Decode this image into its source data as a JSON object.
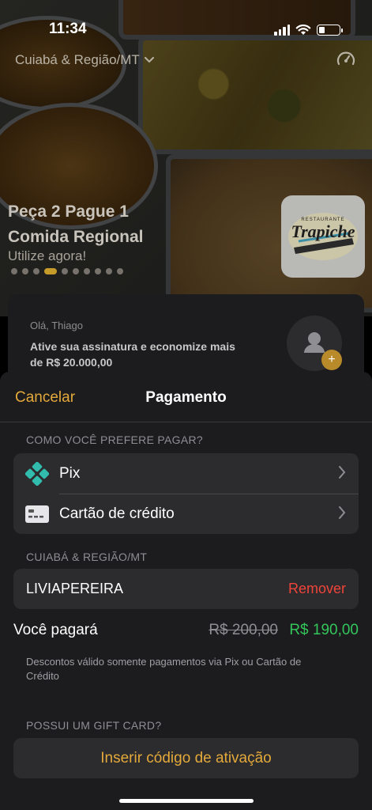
{
  "status_bar": {
    "time": "11:34"
  },
  "background": {
    "region": "Cuiabá & Região/MT",
    "promo": {
      "title_line1": "Peça 2 Pague 1",
      "title_line2": "Comida Regional",
      "subtitle": "Utilize agora!",
      "carousel": {
        "total": 10,
        "active_index": 3
      }
    },
    "logo": {
      "top_text": "RESTAURANTE",
      "name": "Trapiche"
    },
    "greeting": {
      "hello": "Olá, Thiago",
      "message": "Ative sua assinatura e economize mais de  R$ 20.000,00"
    }
  },
  "sheet": {
    "cancel_label": "Cancelar",
    "title": "Pagamento",
    "payment_section_label": "COMO VOCÊ PREFERE PAGAR?",
    "payment_methods": [
      {
        "label": "Pix",
        "icon": "pix-icon"
      },
      {
        "label": "Cartão de crédito",
        "icon": "credit-card-icon"
      }
    ],
    "region_section_label": "CUIABÁ & REGIÃO/MT",
    "coupon": {
      "code": "LIVIAPEREIRA",
      "remove_label": "Remover"
    },
    "total": {
      "label": "Você pagará",
      "original_price": "R$ 200,00",
      "final_price": "R$ 190,00"
    },
    "disclaimer": "Descontos válido somente pagamentos via Pix ou Cartão de Crédito",
    "gift_section_label": "POSSUI UM GIFT CARD?",
    "gift_button_label": "Inserir código de ativação"
  },
  "colors": {
    "accent": "#e4a93a",
    "danger": "#f0443a",
    "success": "#33c65a",
    "sheet_bg": "#1c1c1e",
    "cell_bg": "#2c2c2e",
    "pix": "#32bcad"
  }
}
